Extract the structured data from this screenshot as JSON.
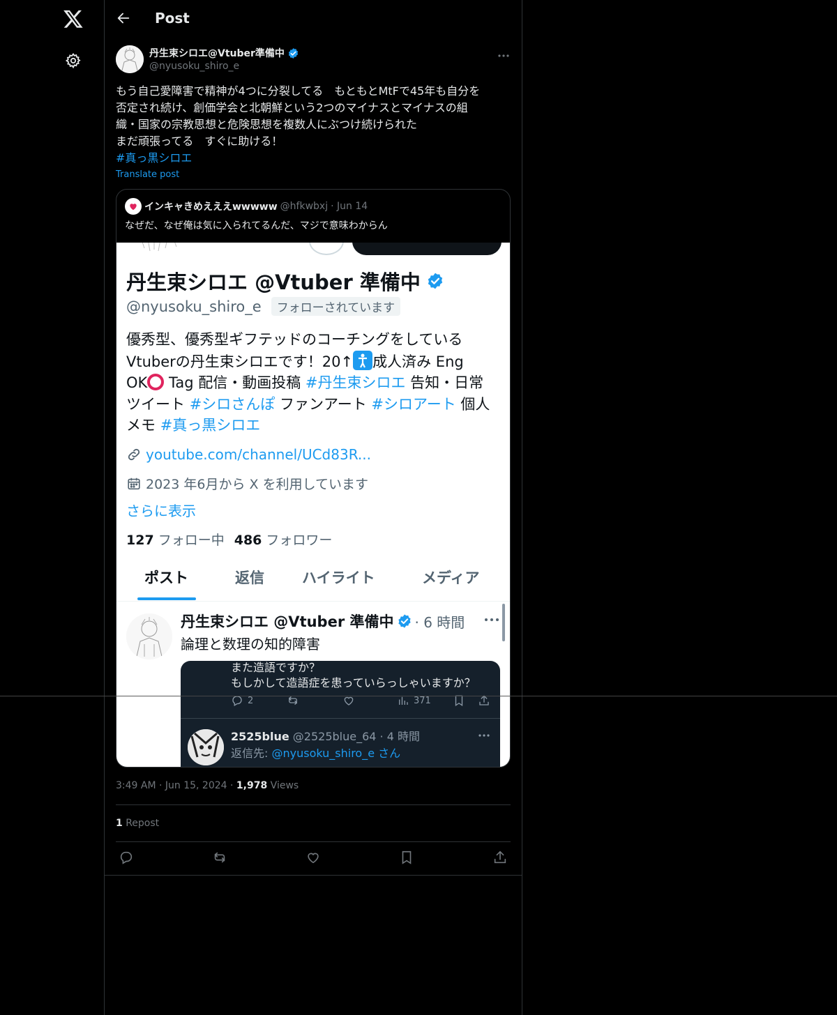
{
  "header": {
    "title": "Post",
    "back_icon": "back-arrow-icon"
  },
  "rail": {
    "logo": "x-logo-icon",
    "settings": "gear-icon"
  },
  "post": {
    "author_name": "丹生束シロエ@Vtuber準備中",
    "author_handle": "@nyusoku_shiro_e",
    "text_lines": [
      "もう自己愛障害で精神が4つに分裂してる　もともとMtFで45年も自分を",
      "否定され続け、創価学会と北朝鮮という2つのマイナスとマイナスの組",
      "織・国家の宗教思想と危険思想を複数人にぶつけ続けられた",
      "まだ頑張ってる　すぐに助ける！"
    ],
    "hashtag": "#真っ黒シロエ",
    "translate": "Translate post",
    "timestamp": "3:49 AM · Jun 15, 2024 · ",
    "views_count": "1,978",
    "views_label": " Views",
    "reposts_count": "1",
    "reposts_label": " Repost"
  },
  "quote": {
    "name": "インキャきめえええwwwww",
    "handle": "@hfkwbxj",
    "date": "· Jun 14",
    "text": "なぜだ、なぜ俺は気に入られてるんだ、マジで意味わからん"
  },
  "embedded_profile": {
    "name": "丹生束シロエ @Vtuber 準備中",
    "handle": "@nyusoku_shiro_e",
    "follows_you": "フォローされています",
    "bio": {
      "l1": "優秀型、優秀型ギフテッドのコーチングをしている",
      "l2a": "Vtuberの丹生束シロエです！20↑",
      "l2b": "成人済み Eng",
      "l3a": "OK",
      "l3b": " Tag 配信・動画投稿 ",
      "l3tag": "#丹生束シロエ",
      "l3c": " 告知・日常",
      "l4a": "ツイート ",
      "l4tag1": "#シロさんぽ",
      "l4b": " ファンアート ",
      "l4tag2": "#シロアート",
      "l4c": " 個人",
      "l5a": "メモ ",
      "l5tag": "#真っ黒シロエ"
    },
    "link": "youtube.com/channel/UCd83R...",
    "joined": "2023 年6月から X を利用しています",
    "show_more": "さらに表示",
    "following_count": "127",
    "following_label": " フォロー中",
    "followers_count": "486",
    "followers_label": " フォロワー",
    "tabs": [
      "ポスト",
      "返信",
      "ハイライト",
      "メディア"
    ],
    "tweet": {
      "name": "丹生束シロエ @Vtuber 準備中",
      "time": "· 6 時間",
      "text": "論理と数理の知的障害"
    },
    "dark_card": {
      "line1": "また造語ですか？",
      "line2": "もしかして造語症を患っていらっしゃいますか？",
      "reply_count": "2",
      "view_count": "371",
      "reply_name": "2525blue",
      "reply_meta": " @2525blue_64 · 4 時間",
      "reply_to_prefix": "返信先: ",
      "reply_to_handle": "@nyusoku_shiro_e さん"
    }
  },
  "colors": {
    "accent": "#1d9bf0",
    "background": "#000000",
    "border": "#2f3336",
    "muted": "#71767b"
  }
}
